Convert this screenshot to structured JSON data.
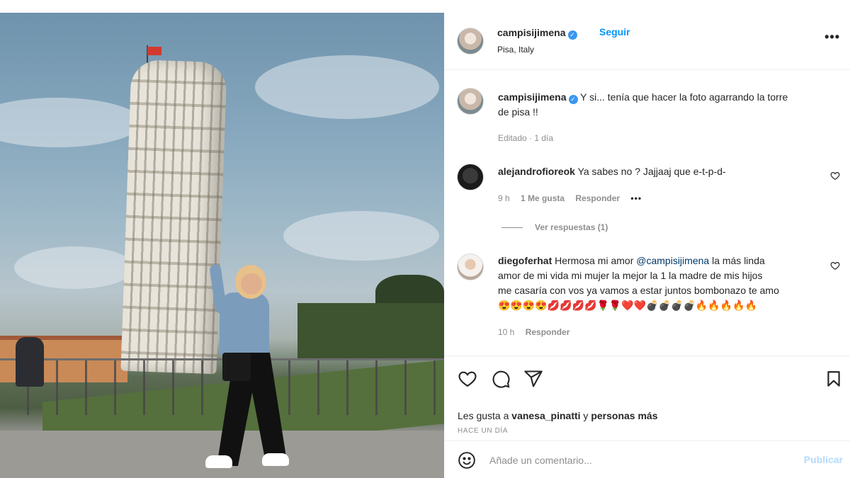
{
  "post": {
    "author": "campisijimena",
    "follow_label": "Seguir",
    "location": "Pisa, Italy",
    "more_label": "•••",
    "caption_line1": "Y si... tenía que hacer la foto agarrando la torre",
    "caption_line2": "de pisa !!",
    "caption_meta": "Editado · 1 día"
  },
  "comments": [
    {
      "user": "alejandrofioreok",
      "text": "Ya sabes no ? Jajjaaj que e-t-p-d-",
      "time": "9 h",
      "likes": "1 Me gusta",
      "reply": "Responder",
      "options": "•••",
      "view_replies": "Ver respuestas (1)"
    },
    {
      "user": "diegoferhat",
      "text_pre": "Hermosa mi amor ",
      "mention": "@campisijimena",
      "text_post": " la más linda",
      "line2": "amor de mi vida mi mujer la mejor la 1 la madre de mis hijos",
      "line3": "me casaría con vos ya vamos a estar juntos bombonazo te amo",
      "emojis": "😍😍😍😍💋💋💋💋🌹🌹❤️❤️💣💣💣💣🔥🔥🔥🔥🔥",
      "time": "10 h",
      "reply": "Responder"
    }
  ],
  "footer": {
    "likes_pre": "Les gusta a ",
    "likes_user": "vanesa_pinatti",
    "likes_mid": " y ",
    "likes_post": "personas más",
    "time_ago": "HACE UN DÍA",
    "comment_placeholder": "Añade un comentario...",
    "publish_label": "Publicar"
  },
  "colors": {
    "accent": "#0095f6",
    "publish_disabled": "#b3dbff",
    "verified": "#3897f0",
    "secondary_text": "#8e8e8e"
  },
  "icons": [
    "verified-badge-icon",
    "more-options-icon",
    "heart-icon",
    "comment-icon",
    "share-icon",
    "bookmark-icon",
    "emoji-icon"
  ]
}
